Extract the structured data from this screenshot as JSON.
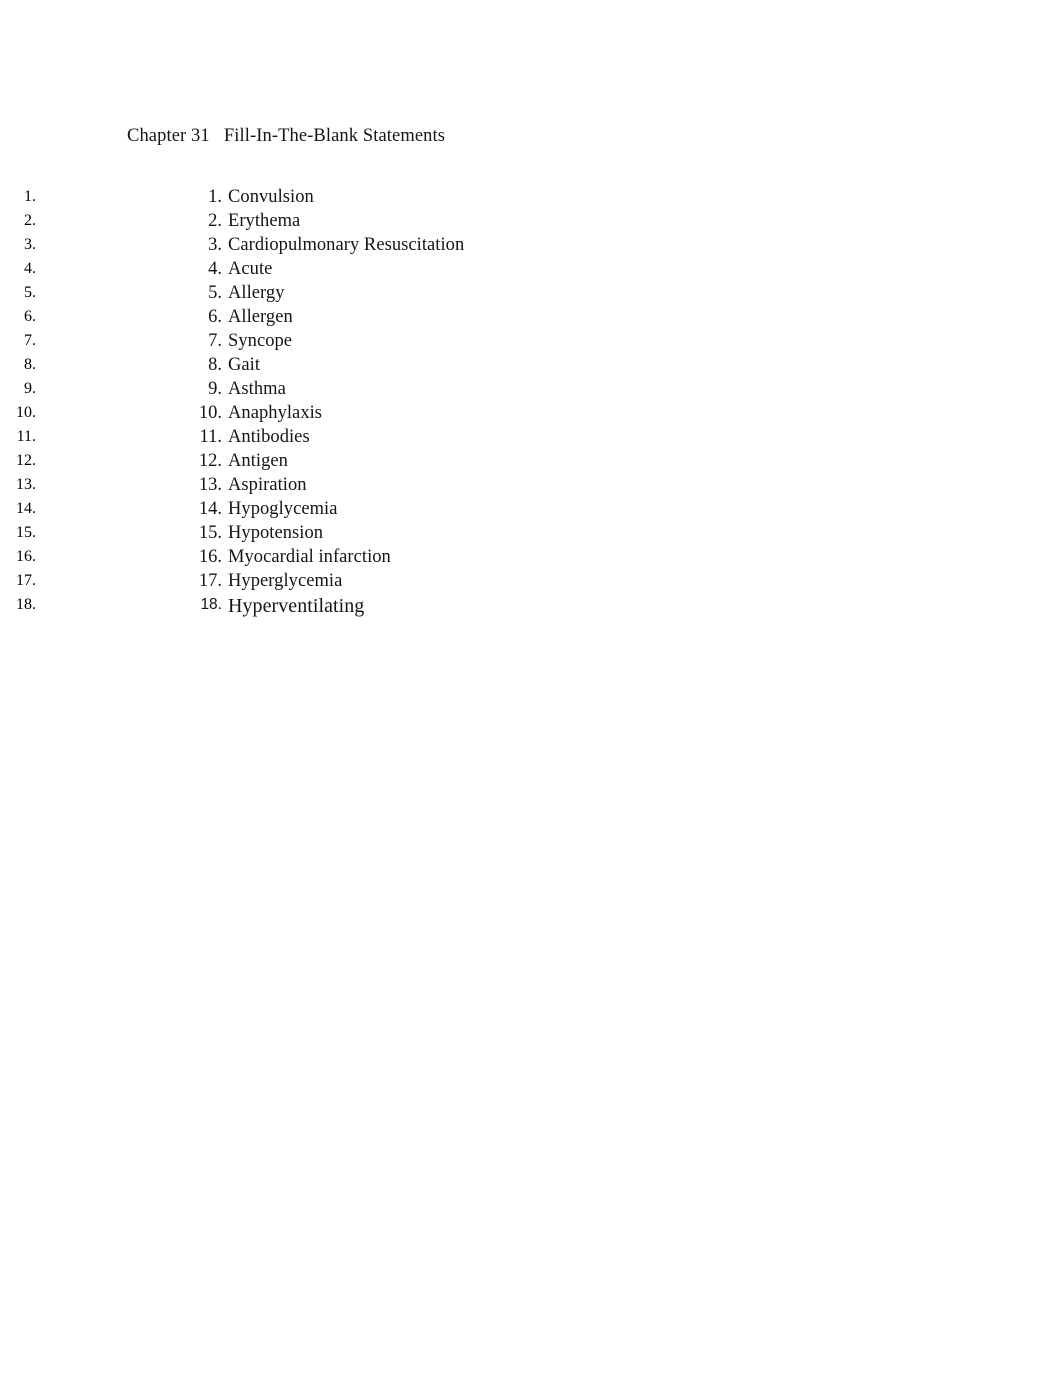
{
  "document": {
    "title": "Chapter 31   Fill-In-The-Blank Statements",
    "background_color": "#ffffff",
    "text_color": "#151515"
  },
  "list": {
    "items": [
      {
        "number": "1.",
        "text": "Convulsion"
      },
      {
        "number": "2.",
        "text": "Erythema"
      },
      {
        "number": "3.",
        "text": "Cardiopulmonary Resuscitation"
      },
      {
        "number": "4.",
        "text": "Acute"
      },
      {
        "number": "5.",
        "text": "Allergy"
      },
      {
        "number": "6.",
        "text": "Allergen"
      },
      {
        "number": "7.",
        "text": "Syncope"
      },
      {
        "number": "8.",
        "text": "Gait"
      },
      {
        "number": "9.",
        "text": "Asthma"
      },
      {
        "number": "10.",
        "text": "Anaphylaxis"
      },
      {
        "number": "11.",
        "text": "Antibodies"
      },
      {
        "number": "12.",
        "text": "Antigen"
      },
      {
        "number": "13.",
        "text": "Aspiration"
      },
      {
        "number": "14.",
        "text": "Hypoglycemia"
      },
      {
        "number": "15.",
        "text": "Hypotension"
      },
      {
        "number": "16.",
        "text": "Myocardial infarction"
      },
      {
        "number": "17.",
        "text": "Hyperglycemia"
      },
      {
        "number": "18.",
        "text": "Hyperventilating"
      }
    ]
  }
}
